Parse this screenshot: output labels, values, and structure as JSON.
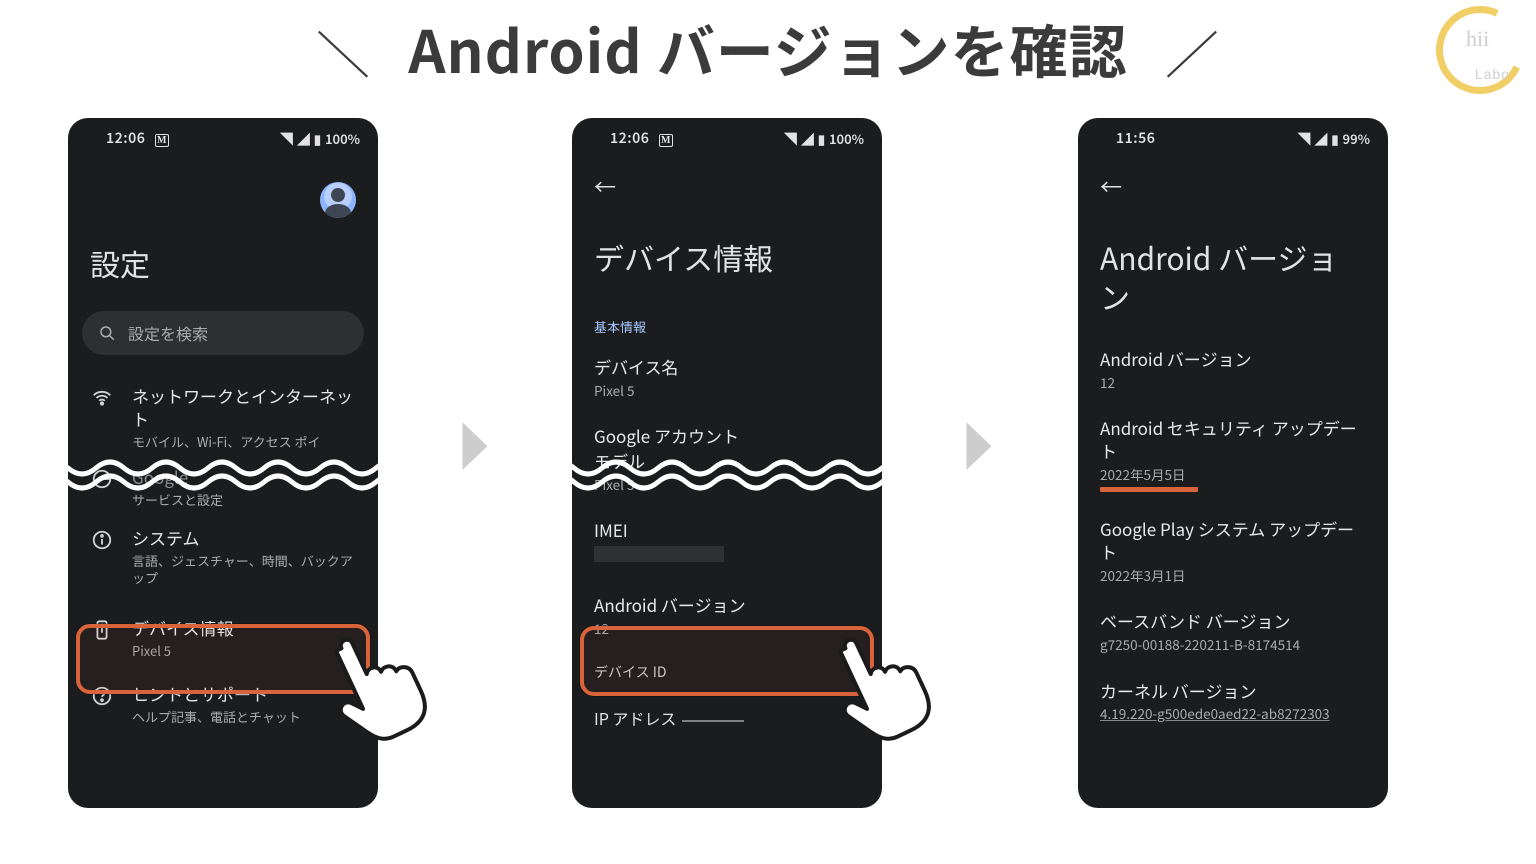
{
  "page_title": "Android バージョンを確認",
  "logo": {
    "main": "hii",
    "sub": "Labo"
  },
  "arrow_glyph": "▶",
  "phone1": {
    "time": "12:06",
    "battery": "100%",
    "title": "設定",
    "search_placeholder": "設定を検索",
    "items": {
      "network": {
        "title": "ネットワークとインターネット",
        "sub": "モバイル、Wi-Fi、アクセス ポイ"
      },
      "google": {
        "title": "Google",
        "sub": "サービスと設定"
      },
      "system": {
        "title": "システム",
        "sub": "言語、ジェスチャー、時間、バックアップ"
      },
      "device": {
        "title": "デバイス情報",
        "sub": "Pixel 5"
      },
      "tips": {
        "title": "ヒントとサポート",
        "sub": "ヘルプ記事、電話とチャット"
      }
    }
  },
  "phone2": {
    "time": "12:06",
    "battery": "100%",
    "title": "デバイス情報",
    "section": "基本情報",
    "rows": {
      "device_name": {
        "title": "デバイス名",
        "sub": "Pixel 5"
      },
      "google_account": {
        "title": "Google アカウント",
        "sub": ""
      },
      "model": {
        "title": "モデル",
        "sub": "Pixel 5"
      },
      "imei": {
        "title": "IMEI"
      },
      "android_ver": {
        "title": "Android バージョン",
        "sub": "12"
      },
      "device_id": {
        "title": "デバイス ID"
      },
      "ip": {
        "title": "IP アドレス"
      }
    }
  },
  "phone3": {
    "time": "11:56",
    "battery": "99%",
    "title": "Android バージョン",
    "rows": {
      "android_version": {
        "title": "Android バージョン",
        "sub": "12"
      },
      "security_update": {
        "title": "Android セキュリティ アップデート",
        "sub": "2022年5月5日"
      },
      "play_system_update": {
        "title": "Google Play システム アップデート",
        "sub": "2022年3月1日"
      },
      "baseband": {
        "title": "ベースバンド バージョン",
        "sub": "g7250-00188-220211-B-8174514"
      },
      "kernel": {
        "title": "カーネル バージョン",
        "sub": "4.19.220-g500ede0aed22-ab8272303"
      }
    }
  }
}
